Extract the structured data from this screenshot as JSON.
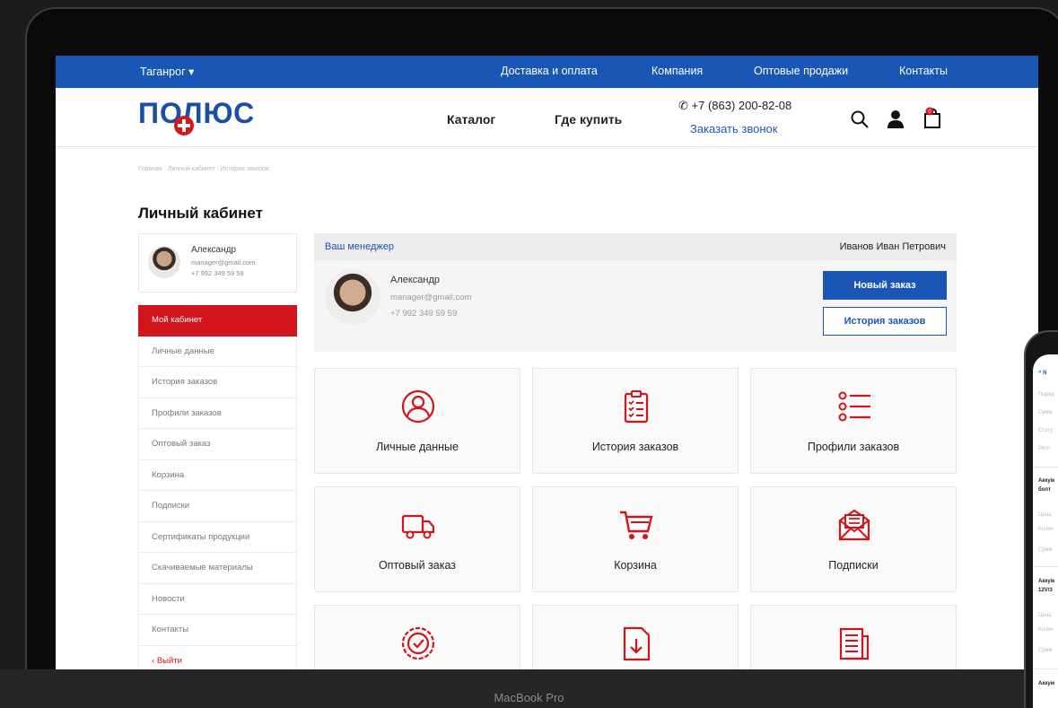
{
  "device_label": "MacBook Pro",
  "topbar": {
    "city": "Таганрог",
    "nav": [
      "Доставка и оплата",
      "Компания",
      "Оптовые продажи",
      "Контакты"
    ]
  },
  "header": {
    "logo": "ПОЛЮС",
    "nav": [
      "Каталог",
      "Где купить"
    ],
    "phone": "+7 (863) 200-82-08",
    "callback": "Заказать звонок",
    "cart_count": "0"
  },
  "breadcrumb": "Главная · Личный кабинет · История заказов",
  "page_title": "Личный кабинет",
  "user": {
    "name": "Александр",
    "email": "manager@gmail.com",
    "phone": "+7 992 349 59 59"
  },
  "side_menu": [
    "Мой кабинет",
    "Личные данные",
    "История заказов",
    "Профили заказов",
    "Оптовый заказ",
    "Корзина",
    "Подписки",
    "Сертификаты продукции",
    "Скачиваемые материалы",
    "Новости",
    "Контакты",
    "Выйти"
  ],
  "manager": {
    "label": "Ваш менеджер",
    "manager_name": "Иванов Иван Петрович",
    "name": "Александр",
    "email": "manager@gmail.com",
    "phone": "+7 992 349 59 59",
    "new_order": "Новый заказ",
    "order_history": "История заказов"
  },
  "tiles": [
    {
      "label": "Личные данные",
      "icon": "user-icon"
    },
    {
      "label": "История заказов",
      "icon": "clipboard-list-icon"
    },
    {
      "label": "Профили заказов",
      "icon": "list-icon"
    },
    {
      "label": "Оптовый заказ",
      "icon": "truck-icon"
    },
    {
      "label": "Корзина",
      "icon": "cart-icon"
    },
    {
      "label": "Подписки",
      "icon": "envelope-icon"
    },
    {
      "label": "",
      "icon": "certificate-badge-icon"
    },
    {
      "label": "",
      "icon": "download-file-icon"
    },
    {
      "label": "",
      "icon": "newspaper-icon"
    }
  ],
  "phone_screen": {
    "lines": [
      "Поряд",
      "Сумм",
      "Стату",
      "Респ",
      "Аккум",
      "болт",
      "Цена",
      "Колич",
      "Сумм",
      "Аккум",
      "12V/3",
      "Цена",
      "Колич",
      "Сумм",
      "Аккум"
    ]
  },
  "colors": {
    "brand_blue": "#1a56b5",
    "accent_red": "#d2141c"
  }
}
